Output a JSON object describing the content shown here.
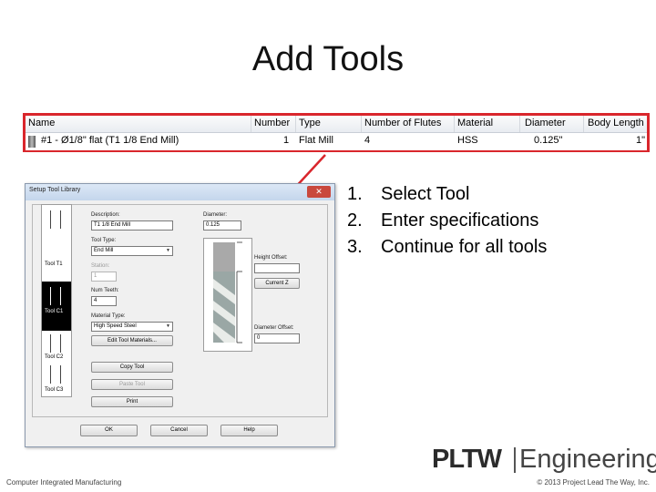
{
  "slide": {
    "title": "Add Tools",
    "steps": [
      {
        "num": "1.",
        "text": "Select Tool"
      },
      {
        "num": "2.",
        "text": "Enter specifications"
      },
      {
        "num": "3.",
        "text": "Continue for all tools"
      }
    ],
    "footer_left": "Computer Integrated Manufacturing",
    "footer_right": "© 2013 Project Lead The Way, Inc.",
    "logo_left": "PLTW",
    "logo_right": "Engineering",
    "colors": {
      "highlight": "#d9262c",
      "arrow": "#d9262c"
    }
  },
  "tool_table": {
    "columns": [
      "Name",
      "Number",
      "Type",
      "Number of Flutes",
      "Material",
      "Diameter",
      "Body Length"
    ],
    "row": {
      "name": "#1 - Ø1/8\" flat (T1 1/8 End Mill)",
      "number": "1",
      "type": "Flat Mill",
      "flutes": "4",
      "material": "HSS",
      "diameter": "0.125\"",
      "body_length": "1\""
    }
  },
  "dialog": {
    "title": "Setup Tool Library",
    "close_icon": "close-icon",
    "tools": [
      "Tool T1",
      "Tool C1",
      "Tool C2",
      "Tool C3"
    ],
    "description_label": "Description:",
    "description_value": "T1 1/8 End Mill",
    "diameter_label": "Diameter:",
    "diameter_value": "0.125",
    "tool_type_label": "Tool Type:",
    "tool_type_value": "End Mill",
    "station_label": "Station:",
    "station_value": "1",
    "num_teeth_label": "Num Teeth:",
    "num_teeth_value": "4",
    "material_type_label": "Material Type:",
    "material_type_value": "High Speed Steel",
    "height_offset_label": "Height Offset:",
    "current_z_label": "Current Z",
    "diameter_offset_label": "Diameter Offset:",
    "diameter_offset_value": "0",
    "edit_materials_label": "Edit Tool Materials...",
    "copy_tool_label": "Copy Tool",
    "paste_tool_label": "Paste Tool",
    "print_label": "Print",
    "ok_label": "OK",
    "cancel_label": "Cancel",
    "help_label": "Help"
  }
}
